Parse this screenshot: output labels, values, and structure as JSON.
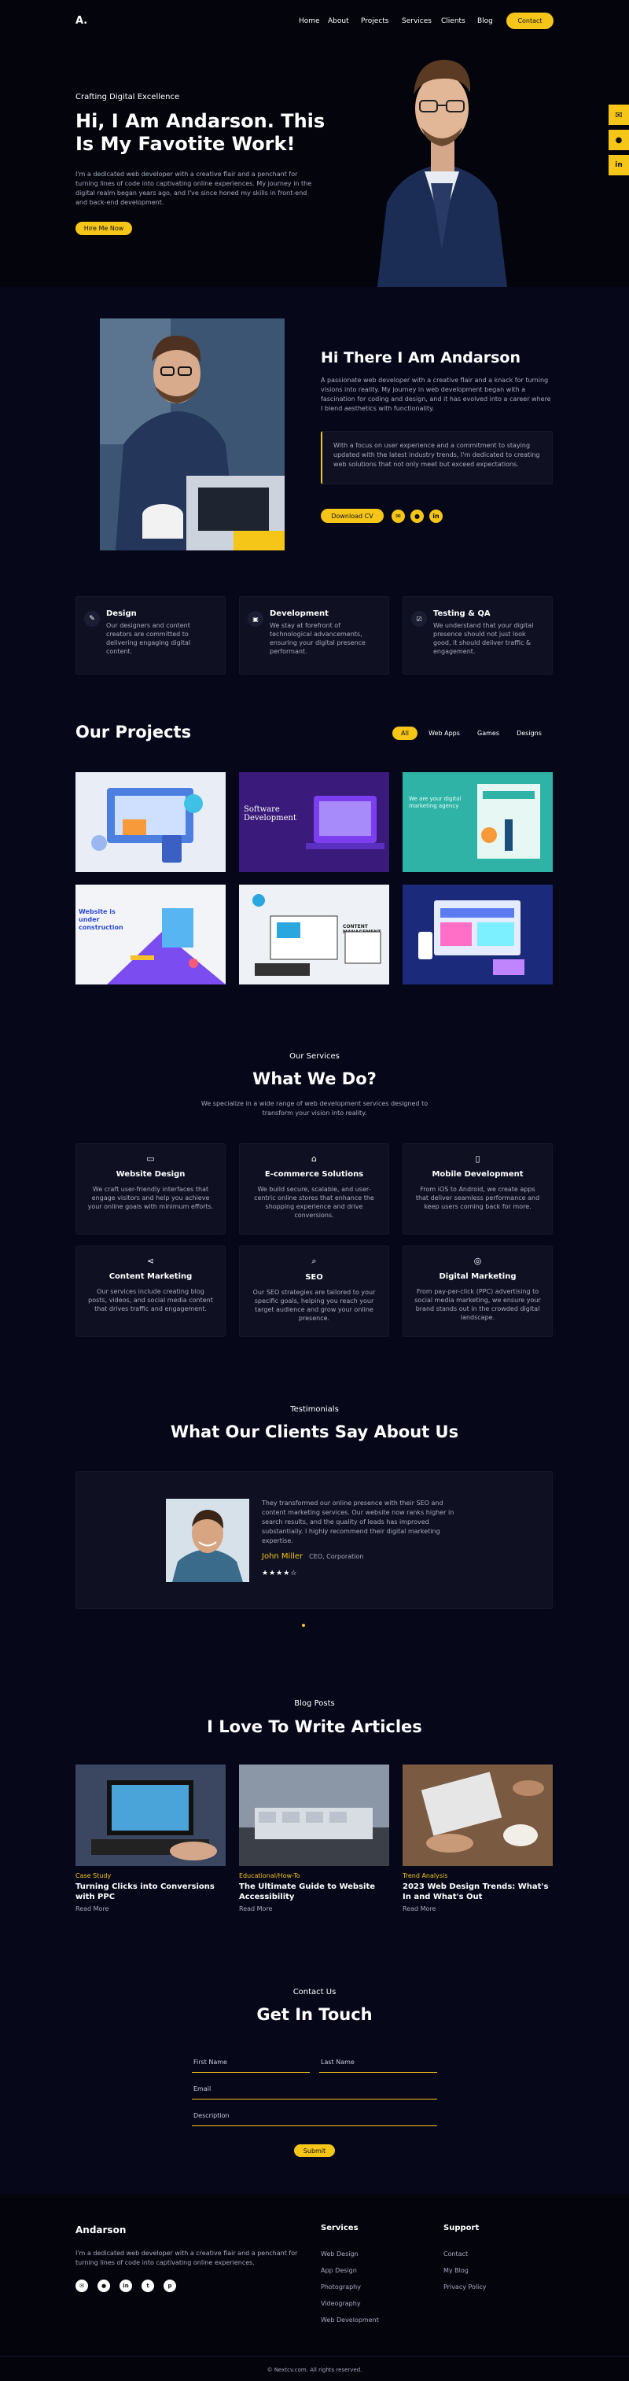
{
  "nav": {
    "logo": "A.",
    "links": [
      "Home",
      "About",
      "Projects",
      "Services",
      "Clients",
      "Blog"
    ],
    "contact": "Contact"
  },
  "hero": {
    "kicker": "Crafting Digital Excellence",
    "title_line1": "Hi, I Am Andarson. This",
    "title_line2": "Is My Favotite Work!",
    "desc": "I'm a dedicated web developer with a creative flair and a penchant for turning lines of code into captivating online experiences. My journey in the digital realm began years ago, and I've since honed my skills in front-end and back-end development.",
    "cta": "Hire Me Now"
  },
  "side_social": [
    "mail-icon",
    "github-icon",
    "linkedin-icon"
  ],
  "about": {
    "title": "Hi There I Am Andarson",
    "desc": "A passionate web developer with a creative flair and a knack for turning visions into reality. My journey in web development began with a fascination for coding and design, and it has evolved into a career where I blend aesthetics with functionality.",
    "quote": "With a focus on user experience and a commitment to staying updated with the latest industry trends, I'm dedicated to creating web solutions that not only meet but exceed expectations.",
    "download": "Download CV"
  },
  "skills": [
    {
      "title": "Design",
      "desc": "Our designers and content creators are committed to delivering engaging digital content.",
      "icon": "pen-tool-icon"
    },
    {
      "title": "Development",
      "desc": "We stay at forefront of technological advancements, ensuring your digital presence performant.",
      "icon": "code-window-icon"
    },
    {
      "title": "Testing & QA",
      "desc": "We understand that your digital presence should not just look good, it should deliver traffic & engagement.",
      "icon": "checkbox-icon"
    }
  ],
  "projects": {
    "title": "Our Projects",
    "filters": [
      "All",
      "Web Apps",
      "Games",
      "Designs"
    ],
    "items": [
      {
        "label": "",
        "bg": "#e9eef6"
      },
      {
        "label": "Software Development",
        "bg": "#3a1a7a"
      },
      {
        "label": "We are your digital marketing agency",
        "bg": "#2fb3a6"
      },
      {
        "label": "Website is under construction",
        "bg": "#f3f4f8"
      },
      {
        "label": "CONTENT MANAGEMENT",
        "bg": "#eef1f6"
      },
      {
        "label": "",
        "bg": "#1b2a7a"
      }
    ]
  },
  "services": {
    "kicker": "Our Services",
    "title": "What We Do?",
    "desc": "We specialize in a wide range of web development services designed to transform your vision into reality.",
    "items": [
      {
        "title": "Website Design",
        "desc": "We craft user-friendly interfaces that engage visitors and help you achieve your online goals with minimum efforts.",
        "icon": "browser-icon"
      },
      {
        "title": "E-commerce Solutions",
        "desc": "We build secure, scalable, and user-centric online stores that enhance the shopping experience and drive conversions.",
        "icon": "store-icon"
      },
      {
        "title": "Mobile Development",
        "desc": "From iOS to Android, we create apps that deliver seamless performance and keep users coming back for more.",
        "icon": "phone-icon"
      },
      {
        "title": "Content Marketing",
        "desc": "Our services include creating blog posts, videos, and social media content that drives traffic and engagement.",
        "icon": "share-icon"
      },
      {
        "title": "SEO",
        "desc": "Our SEO strategies are tailored to your specific goals, helping you reach your target audience and grow your online presence.",
        "icon": "search-chat-icon"
      },
      {
        "title": "Digital Marketing",
        "desc": "From pay-per-click (PPC) advertising to social media marketing, we ensure your brand stands out in the crowded digital landscape.",
        "icon": "target-icon"
      }
    ]
  },
  "testimonials": {
    "kicker": "Testimonials",
    "title": "What Our Clients Say About Us",
    "quote": "They transformed our online presence with their SEO and content marketing services. Our website now ranks higher in search results, and the quality of leads has improved substantially. I highly recommend their digital marketing expertise.",
    "name": "John Miller",
    "role": "CEO, Corporation",
    "rating": 4
  },
  "blog": {
    "kicker": "Blog Posts",
    "title": "I Love To Write Articles",
    "posts": [
      {
        "category": "Case Study",
        "title": "Turning Clicks into Conversions with PPC",
        "more": "Read More",
        "bg": "#2a3550"
      },
      {
        "category": "Educational/How-To",
        "title": "The Ultimate Guide to Website Accessibility",
        "more": "Read More",
        "bg": "#6b7a8c"
      },
      {
        "category": "Trend Analysis",
        "title": "2023 Web Design Trends: What's In and What's Out",
        "more": "Read More",
        "bg": "#8a6a50"
      }
    ]
  },
  "contact": {
    "kicker": "Contact Us",
    "title": "Get In Touch",
    "first_name": "First Name",
    "last_name": "Last Name",
    "email": "Email",
    "description": "Description",
    "submit": "Submit"
  },
  "footer": {
    "brand": "Andarson",
    "desc": "I'm a dedicated web developer with a creative flair and a penchant for turning lines of code into captivating online experiences.",
    "social": [
      "mail-icon",
      "github-icon",
      "linkedin-icon",
      "twitter-icon",
      "pinterest-icon"
    ],
    "services_title": "Services",
    "services": [
      "Web Design",
      "App Design",
      "Photography",
      "Videography",
      "Web Development"
    ],
    "support_title": "Support",
    "support": [
      "Contact",
      "My Blog",
      "Privacy Policy"
    ],
    "copyright": "© Nextcv.com. All rights reserved."
  },
  "colors": {
    "accent": "#f5c518",
    "bg": "#06081a",
    "card": "#0f1123"
  }
}
